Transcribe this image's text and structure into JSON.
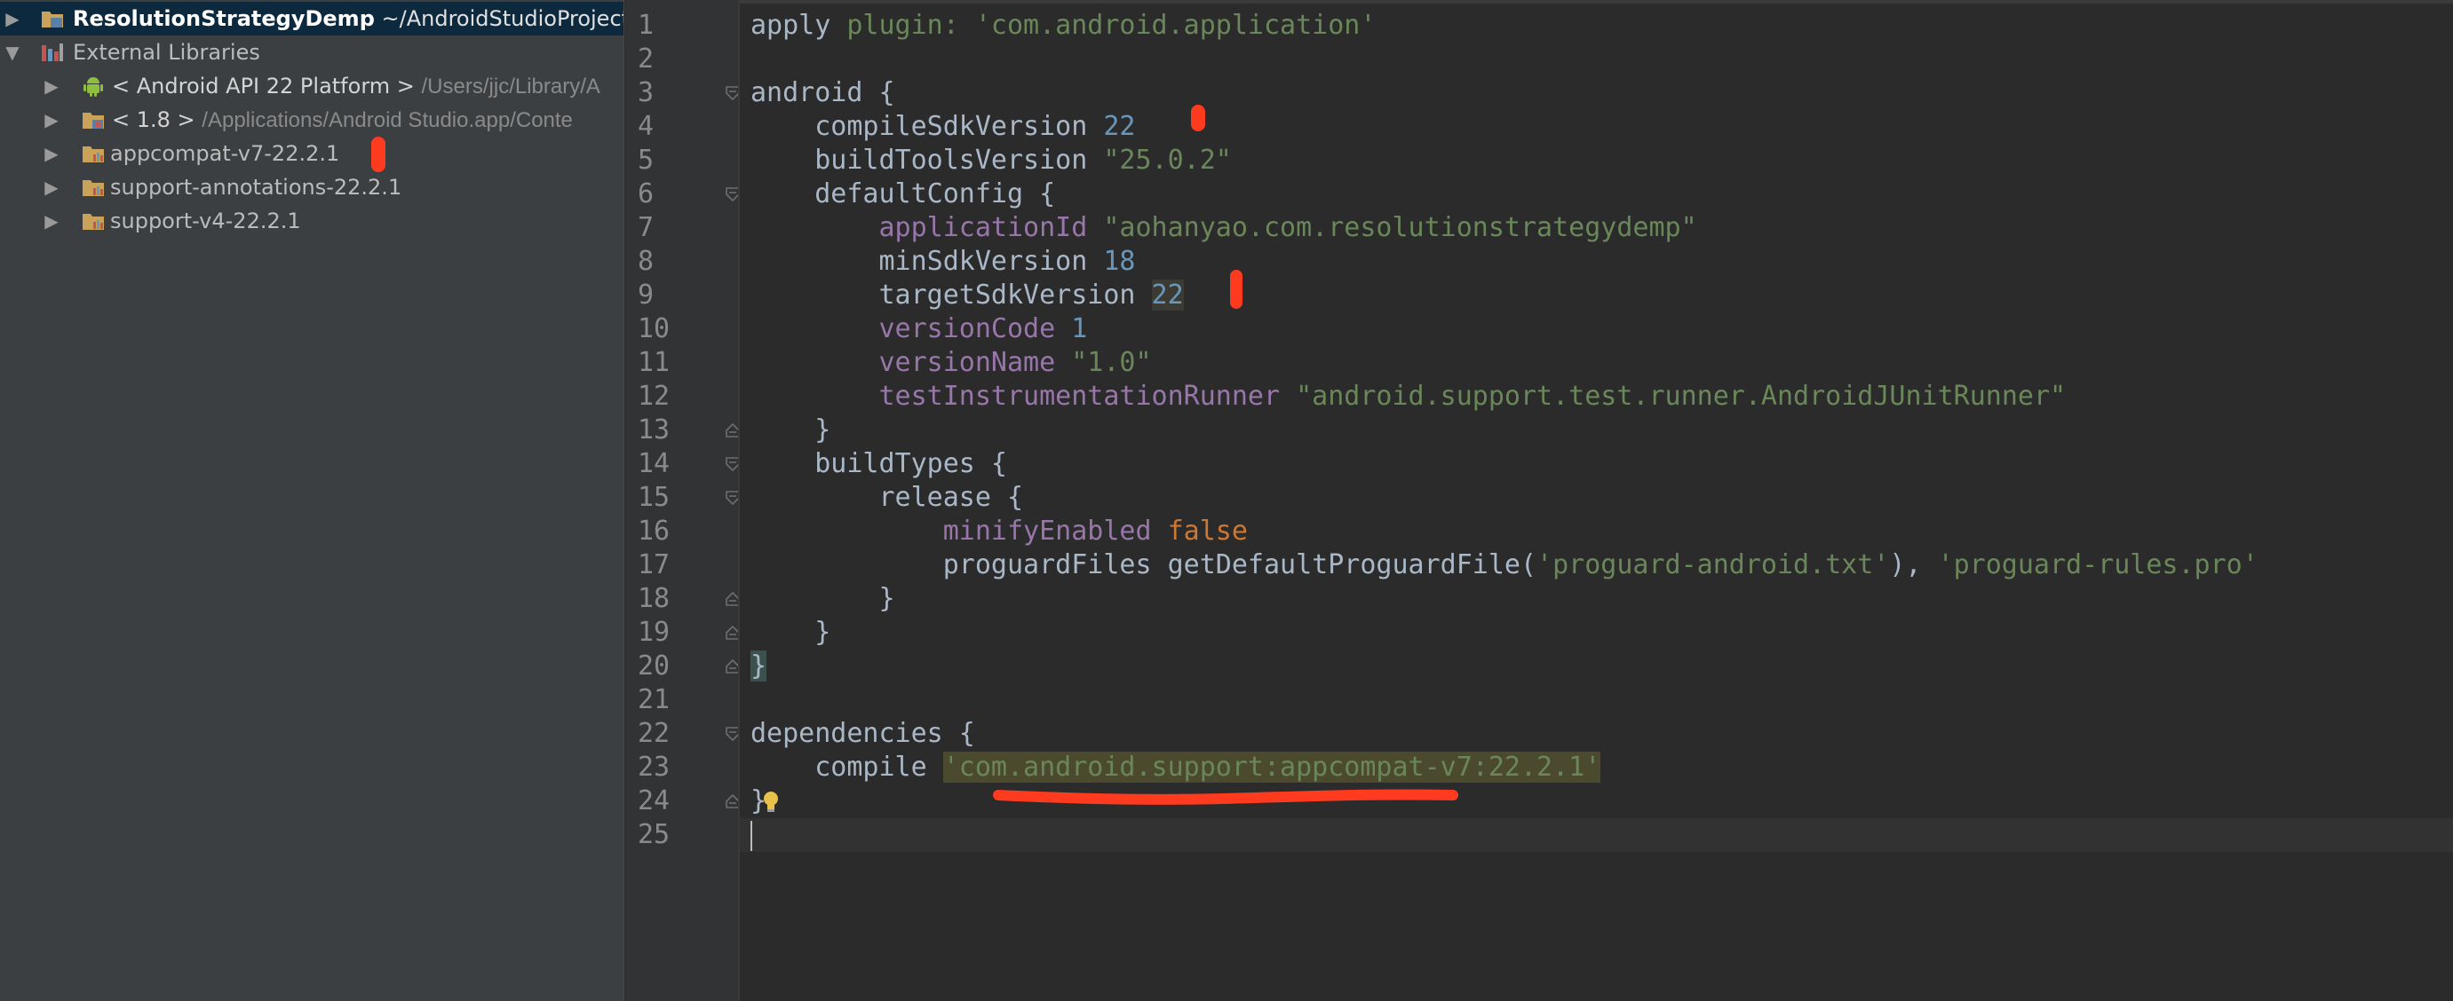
{
  "project_tree": {
    "root": {
      "name": "ResolutionStrategyDemp",
      "path": "~/AndroidStudioProjects/"
    },
    "external_libraries": {
      "label": "External Libraries"
    },
    "libraries": [
      {
        "name": "< Android API 22 Platform >",
        "path": "/Users/jjc/Library/A"
      },
      {
        "name": "< 1.8 >",
        "path": "/Applications/Android Studio.app/Conte"
      },
      {
        "name": "appcompat-v7-22.2.1",
        "path": ""
      },
      {
        "name": "support-annotations-22.2.1",
        "path": ""
      },
      {
        "name": "support-v4-22.2.1",
        "path": ""
      }
    ]
  },
  "editor": {
    "line_numbers": [
      "1",
      "2",
      "3",
      "4",
      "5",
      "6",
      "7",
      "8",
      "9",
      "10",
      "11",
      "12",
      "13",
      "14",
      "15",
      "16",
      "17",
      "18",
      "19",
      "20",
      "21",
      "22",
      "23",
      "24",
      "25"
    ],
    "lines": {
      "l1": {
        "t1": "apply ",
        "t2": "plugin: ",
        "t3": "'com.android.application'"
      },
      "l3": {
        "t1": "android {"
      },
      "l4": {
        "t1": "    compileSdkVersion ",
        "t2": "22"
      },
      "l5": {
        "t1": "    buildToolsVersion ",
        "t2": "\"25.0.2\""
      },
      "l6": {
        "t1": "    defaultConfig {"
      },
      "l7": {
        "t1": "        ",
        "t2": "applicationId ",
        "t3": "\"aohanyao.com.resolutionstrategydemp\""
      },
      "l8": {
        "t1": "        minSdkVersion ",
        "t2": "18"
      },
      "l9": {
        "t1": "        targetSdkVersion ",
        "t2": "22"
      },
      "l10": {
        "t1": "        ",
        "t2": "versionCode ",
        "t3": "1"
      },
      "l11": {
        "t1": "        ",
        "t2": "versionName ",
        "t3": "\"1.0\""
      },
      "l12": {
        "t1": "        ",
        "t2": "testInstrumentationRunner ",
        "t3": "\"android.support.test.runner.AndroidJUnitRunner\""
      },
      "l13": {
        "t1": "    }"
      },
      "l14": {
        "t1": "    buildTypes {"
      },
      "l15": {
        "t1": "        release {"
      },
      "l16": {
        "t1": "            ",
        "t2": "minifyEnabled ",
        "t3": "false"
      },
      "l17": {
        "t1": "            proguardFiles getDefaultProguardFile(",
        "t2": "'proguard-android.txt'",
        "t3": "), ",
        "t4": "'proguard-rules.pro'"
      },
      "l18": {
        "t1": "        }"
      },
      "l19": {
        "t1": "    }"
      },
      "l20": {
        "t1": "}"
      },
      "l22": {
        "t1": "dependencies {"
      },
      "l23": {
        "t1": "    compile ",
        "t2": "'com.android.support:appcompat-v7:22.2.1'"
      },
      "l24": {
        "t1": "}"
      }
    }
  },
  "colors": {
    "editor_bg": "#2b2b2b",
    "panel_bg": "#3c3f41",
    "string": "#6a8759",
    "number": "#6897bb",
    "property": "#9876aa",
    "keyword": "#cc7832",
    "annotation": "#ff3b1f"
  },
  "icons": [
    "expand-arrow-icon",
    "module-folder-icon",
    "library-icon",
    "android-icon",
    "jdk-folder-icon",
    "jar-folder-icon",
    "fold-icon",
    "lightbulb-icon"
  ]
}
